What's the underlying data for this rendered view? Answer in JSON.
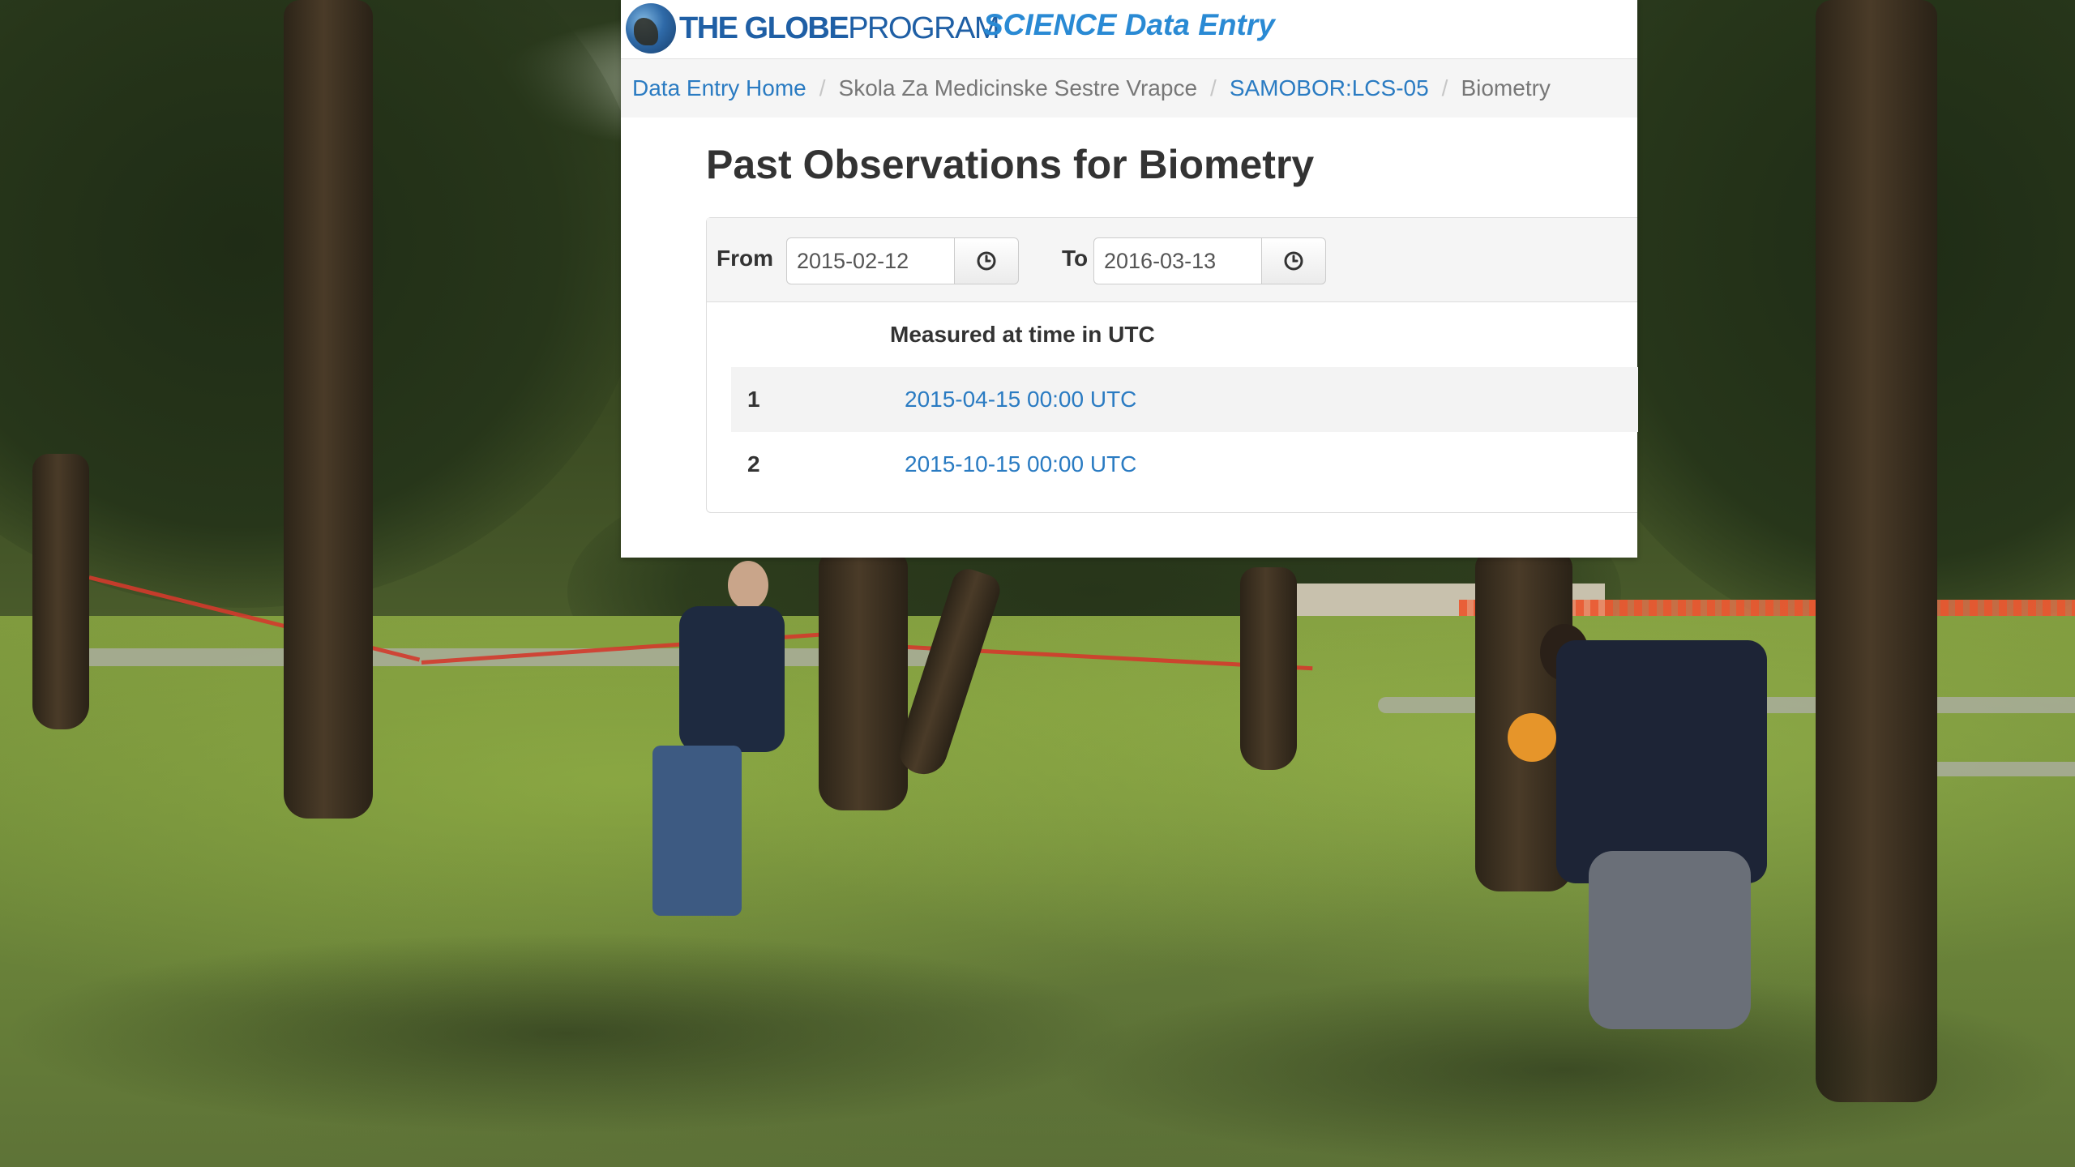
{
  "header": {
    "logo_the_globe": "THE GLOBE",
    "logo_program": "PROGRAM",
    "app_title": "SCIENCE Data Entry"
  },
  "breadcrumb": {
    "home": "Data Entry Home",
    "school": "Skola Za Medicinske Sestre Vrapce",
    "site": "SAMOBOR:LCS-05",
    "current": "Biometry",
    "separator": "/"
  },
  "main": {
    "title": "Past Observations for Biometry",
    "filter": {
      "from_label": "From",
      "from_value": "2015-02-12",
      "to_label": "To",
      "to_value": "2016-03-13"
    },
    "table": {
      "column_header": "Measured at time in UTC",
      "rows": [
        {
          "index": "1",
          "time": "2015-04-15 00:00 UTC"
        },
        {
          "index": "2",
          "time": "2015-10-15 00:00 UTC"
        }
      ]
    }
  },
  "colors": {
    "link": "#2a7bc2",
    "app_title": "#2a8ad4",
    "logo": "#1f5fa5"
  },
  "icons": {
    "logo": "globe-logo-icon",
    "date_picker": "clock-icon"
  }
}
